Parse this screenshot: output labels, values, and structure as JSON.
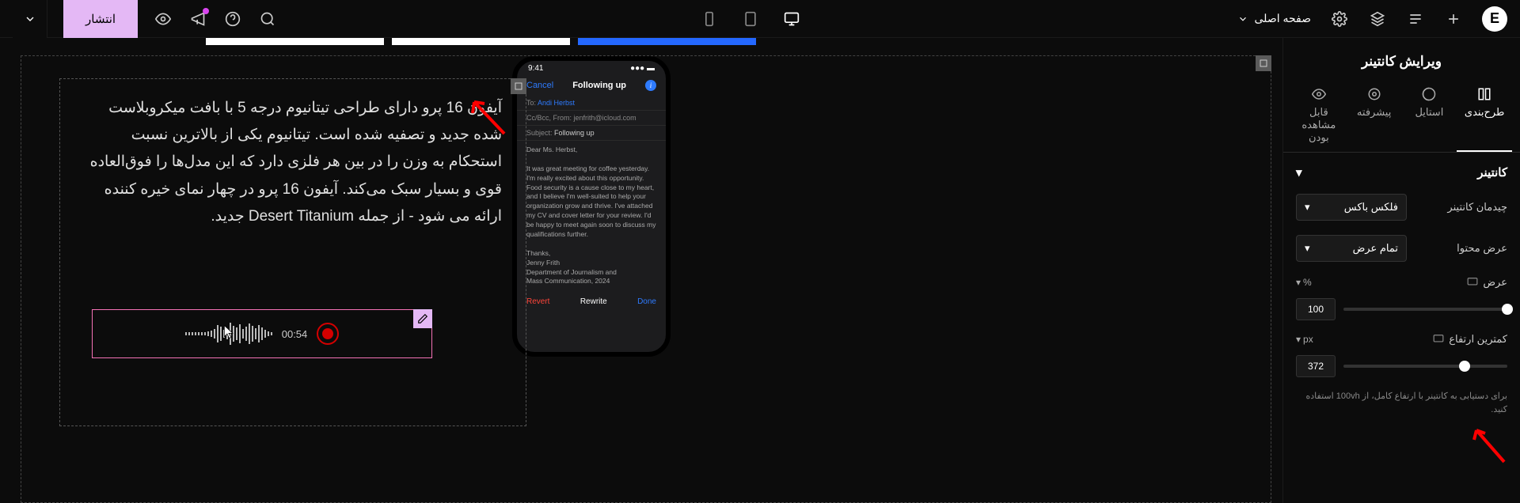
{
  "topbar": {
    "publish": "انتشار",
    "page_label": "صفحه اصلی"
  },
  "panel": {
    "title": "ویرایش کانتینر",
    "tabs": {
      "layout": "طرح‌بندی",
      "style": "استایل",
      "advanced": "پیشرفته",
      "visibility": "قابل مشاهده بودن"
    },
    "section": "کانتینر",
    "rows": {
      "layout_label": "چیدمان کانتینر",
      "layout_val": "فلکس باکس",
      "content_width_label": "عرض محتوا",
      "content_width_val": "تمام عرض",
      "width_label": "عرض",
      "width_unit": "%",
      "width_val": "100",
      "min_height_label": "کمترین ارتفاع",
      "min_height_unit": "px",
      "min_height_val": "372"
    },
    "hint": "برای دستیابی به کانتینر با ارتفاع کامل، از 100vh استفاده کنید."
  },
  "canvas": {
    "paragraph": "آیفون 16 پرو دارای طراحی تیتانیوم درجه 5 با بافت میکروبلاست شده جدید و تصفیه شده است. تیتانیوم یکی از بالاترین نسبت استحکام به وزن را در بین هر فلزی دارد که این مدل‌ها را فوق‌العاده قوی و بسیار سبک می‌کند. آیفون 16 پرو در چهار نمای خیره کننده ارائه می شود - از جمله Desert Titanium جدید.",
    "audio_time": "00:54"
  },
  "phone": {
    "time": "9:41",
    "cancel": "Cancel",
    "title": "Following up",
    "to_lbl": "To:",
    "to_val": "Andi Herbst",
    "cc": "Cc/Bcc, From: jenfrith@icloud.com",
    "subj_lbl": "Subject:",
    "subj_val": "Following up",
    "greeting": "Dear Ms. Herbst,",
    "body": "It was great meeting for coffee yesterday. I'm really excited about this opportunity. Food security is a cause close to my heart, and I believe I'm well-suited to help your organization grow and thrive. I've attached my CV and cover letter for your review. I'd be happy to meet again soon to discuss my qualifications further.",
    "sign1": "Thanks,",
    "sign2": "Jenny Frith",
    "sign3": "Department of Journalism and",
    "sign4": "Mass Communication, 2024",
    "revert": "Revert",
    "rewrite": "Rewrite",
    "done": "Done"
  }
}
